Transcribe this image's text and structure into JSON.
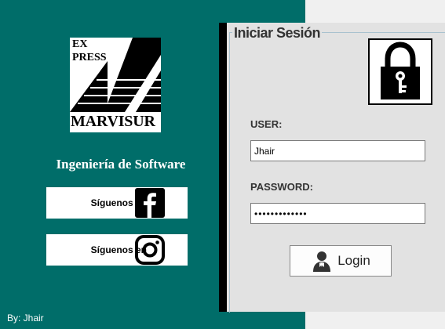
{
  "brand": {
    "logo_line1": "EX",
    "logo_line2": "PRESS",
    "logo_name": "MARVISUR",
    "subtitle": "Ingeniería de Software"
  },
  "social": {
    "facebook_label": "Síguenos en",
    "instagram_label": "Síguenos en"
  },
  "footer": {
    "author": "By: Jhair"
  },
  "login": {
    "title": "Iniciar Sesión",
    "user_label": "USER:",
    "user_value": "Jhair",
    "password_label": "PASSWORD:",
    "password_value": "•••••••••••••",
    "button_label": "Login"
  },
  "icons": {
    "lock": "lock-key-icon",
    "facebook": "facebook-icon",
    "instagram": "instagram-icon",
    "user": "user-icon"
  },
  "colors": {
    "left_panel": "#006d69",
    "login_panel": "#e2e2e2",
    "accent_bar": "#000000"
  }
}
